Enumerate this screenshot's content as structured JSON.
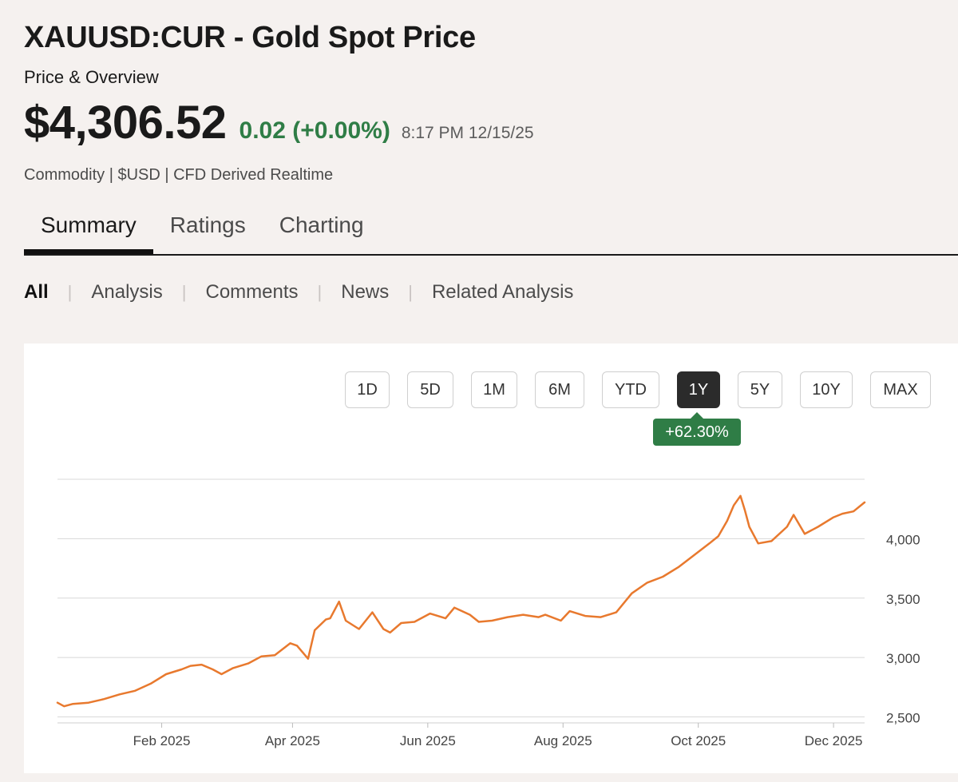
{
  "header": {
    "title": "XAUUSD:CUR - Gold Spot Price",
    "subtitle": "Price & Overview",
    "price": "$4,306.52",
    "change": "0.02 (+0.00%)",
    "timestamp": "8:17 PM 12/15/25",
    "meta": "Commodity | $USD | CFD Derived Realtime"
  },
  "tabs": [
    "Summary",
    "Ratings",
    "Charting"
  ],
  "subnav": [
    "All",
    "Analysis",
    "Comments",
    "News",
    "Related Analysis"
  ],
  "ranges": [
    "1D",
    "5D",
    "1M",
    "6M",
    "YTD",
    "1Y",
    "5Y",
    "10Y",
    "MAX"
  ],
  "active_range": "1Y",
  "performance_badge": "+62.30%",
  "colors": {
    "line": "#e8792e",
    "positive": "#2f7d46",
    "active_button": "#2b2b2b"
  },
  "chart_data": {
    "type": "line",
    "title": "",
    "xlabel": "",
    "ylabel": "",
    "ylim": [
      2450,
      4500
    ],
    "y_ticks": [
      2500,
      3000,
      3500,
      4000
    ],
    "y_tick_labels": [
      "2,500",
      "3,000",
      "3,500",
      "4,000"
    ],
    "x_tick_labels": [
      "Feb 2025",
      "Apr 2025",
      "Jun 2025",
      "Aug 2025",
      "Oct 2025",
      "Dec 2025"
    ],
    "x_ticks": [
      "2025-02-01",
      "2025-04-01",
      "2025-06-01",
      "2025-08-01",
      "2025-10-01",
      "2025-12-01"
    ],
    "x_range": [
      "2024-12-16",
      "2025-12-15"
    ],
    "grid": true,
    "series": [
      {
        "name": "",
        "x": [
          "2024-12-16",
          "2024-12-19",
          "2024-12-23",
          "2024-12-30",
          "2025-01-06",
          "2025-01-13",
          "2025-01-20",
          "2025-01-27",
          "2025-02-03",
          "2025-02-10",
          "2025-02-14",
          "2025-02-19",
          "2025-02-24",
          "2025-02-28",
          "2025-03-05",
          "2025-03-12",
          "2025-03-18",
          "2025-03-24",
          "2025-03-31",
          "2025-04-03",
          "2025-04-08",
          "2025-04-11",
          "2025-04-16",
          "2025-04-18",
          "2025-04-22",
          "2025-04-25",
          "2025-05-01",
          "2025-05-07",
          "2025-05-12",
          "2025-05-15",
          "2025-05-20",
          "2025-05-26",
          "2025-06-02",
          "2025-06-09",
          "2025-06-13",
          "2025-06-20",
          "2025-06-24",
          "2025-06-30",
          "2025-07-07",
          "2025-07-14",
          "2025-07-21",
          "2025-07-24",
          "2025-07-31",
          "2025-08-04",
          "2025-08-11",
          "2025-08-18",
          "2025-08-25",
          "2025-09-01",
          "2025-09-08",
          "2025-09-15",
          "2025-09-22",
          "2025-09-29",
          "2025-10-06",
          "2025-10-10",
          "2025-10-14",
          "2025-10-17",
          "2025-10-20",
          "2025-10-22",
          "2025-10-24",
          "2025-10-28",
          "2025-11-03",
          "2025-11-10",
          "2025-11-13",
          "2025-11-18",
          "2025-11-24",
          "2025-12-01",
          "2025-12-05",
          "2025-12-10",
          "2025-12-15"
        ],
        "values": [
          2620,
          2590,
          2610,
          2620,
          2650,
          2690,
          2720,
          2780,
          2860,
          2900,
          2930,
          2940,
          2900,
          2860,
          2910,
          2950,
          3010,
          3020,
          3120,
          3100,
          2990,
          3230,
          3320,
          3330,
          3470,
          3310,
          3240,
          3380,
          3240,
          3210,
          3290,
          3300,
          3370,
          3330,
          3420,
          3360,
          3300,
          3310,
          3340,
          3360,
          3340,
          3360,
          3310,
          3390,
          3350,
          3340,
          3380,
          3540,
          3630,
          3680,
          3760,
          3860,
          3960,
          4020,
          4150,
          4280,
          4360,
          4240,
          4100,
          3960,
          3980,
          4100,
          4200,
          4040,
          4100,
          4180,
          4210,
          4230,
          4306
        ]
      }
    ]
  }
}
